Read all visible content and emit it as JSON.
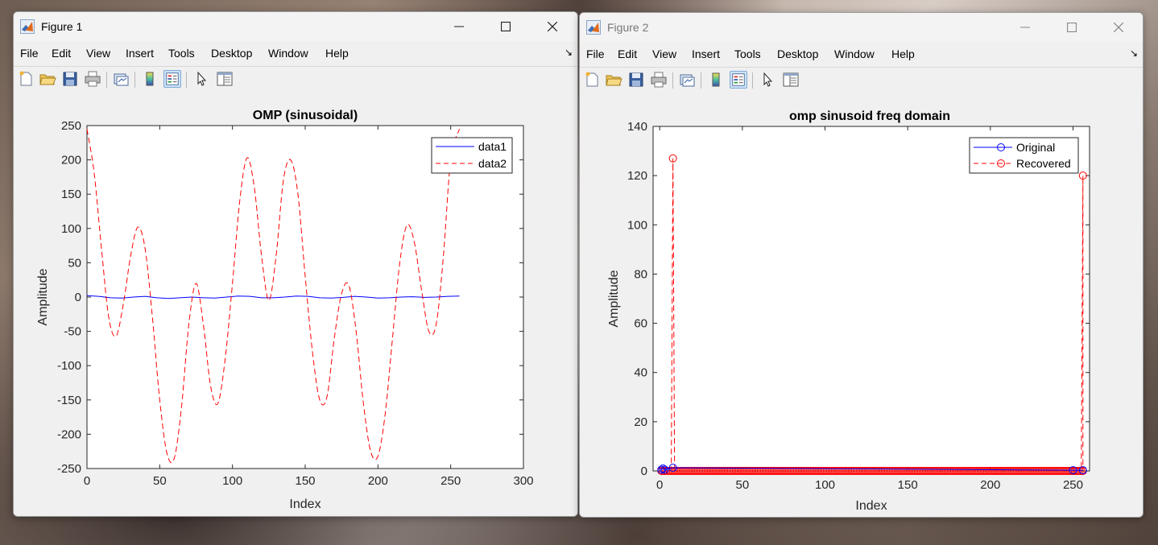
{
  "figure1": {
    "title": "Figure 1",
    "menu": [
      "File",
      "Edit",
      "View",
      "Insert",
      "Tools",
      "Desktop",
      "Window",
      "Help"
    ],
    "chart": {
      "type": "line",
      "title": "OMP (sinusoidal)",
      "xlabel": "Index",
      "ylabel": "Amplitude",
      "xlim": [
        0,
        300
      ],
      "ylim": [
        -250,
        250
      ],
      "xticks": [
        "0",
        "50",
        "100",
        "150",
        "200",
        "250",
        "300"
      ],
      "yticks": [
        "250",
        "200",
        "150",
        "100",
        "50",
        "0",
        "-50",
        "-100",
        "-150",
        "-200",
        "-250"
      ],
      "legend": [
        "data1",
        "data2"
      ],
      "colors": {
        "data1": "#0000ff",
        "data2": "#ff0000"
      }
    }
  },
  "figure2": {
    "title": "Figure 2",
    "menu": [
      "File",
      "Edit",
      "View",
      "Insert",
      "Tools",
      "Desktop",
      "Window",
      "Help"
    ],
    "chart": {
      "type": "scatter",
      "title": "omp sinusoid freq domain",
      "xlabel": "Index",
      "ylabel": "Amplitude",
      "xlim": [
        -4,
        260
      ],
      "ylim": [
        0,
        140
      ],
      "xticks": [
        "0",
        "50",
        "100",
        "150",
        "200",
        "250"
      ],
      "yticks": [
        "140",
        "120",
        "100",
        "80",
        "60",
        "40",
        "20",
        "0"
      ],
      "legend": [
        "Original",
        "Recovered"
      ],
      "colors": {
        "Original": "#0000ff",
        "Recovered": "#ff0000"
      }
    }
  },
  "chart_data": [
    {
      "type": "line",
      "title": "OMP (sinusoidal)",
      "xlabel": "Index",
      "ylabel": "Amplitude",
      "xlim": [
        0,
        300
      ],
      "ylim": [
        -250,
        250
      ],
      "grid": false,
      "legend_position": "top-right",
      "series": [
        {
          "name": "data1",
          "style": "solid",
          "x": [
            0,
            8,
            16,
            24,
            32,
            40,
            48,
            56,
            64,
            72,
            80,
            88,
            96,
            104,
            112,
            120,
            128,
            136,
            144,
            152,
            160,
            168,
            176,
            184,
            192,
            200,
            208,
            216,
            224,
            232,
            240,
            248,
            256
          ],
          "y": [
            2,
            1,
            -1,
            -1.5,
            0,
            1,
            -1,
            -2,
            -1,
            0,
            -1,
            -1.5,
            0,
            1.5,
            1,
            -1,
            -1,
            0,
            1.5,
            1,
            -1,
            -1.5,
            -0.5,
            1,
            0,
            -1.5,
            -1,
            0,
            0.5,
            -0.5,
            0,
            1,
            1.5
          ]
        },
        {
          "name": "data2",
          "style": "dashed",
          "x": [
            0,
            5,
            10,
            15,
            20,
            25,
            30,
            35,
            40,
            45,
            50,
            55,
            60,
            65,
            70,
            75,
            80,
            85,
            90,
            95,
            100,
            105,
            110,
            115,
            120,
            125,
            130,
            135,
            140,
            145,
            150,
            155,
            160,
            165,
            170,
            175,
            180,
            185,
            190,
            195,
            200,
            205,
            210,
            215,
            220,
            225,
            230,
            235,
            240,
            245,
            250,
            256
          ],
          "y": [
            245,
            180,
            70,
            -30,
            -57,
            -10,
            60,
            102,
            70,
            -30,
            -150,
            -228,
            -235,
            -160,
            -40,
            20,
            -40,
            -130,
            -155,
            -90,
            20,
            140,
            203,
            160,
            60,
            -5,
            60,
            170,
            200,
            150,
            30,
            -80,
            -150,
            -145,
            -60,
            5,
            17,
            -50,
            -155,
            -225,
            -232,
            -170,
            -60,
            50,
            105,
            80,
            10,
            -50,
            -40,
            60,
            200,
            245
          ]
        }
      ]
    },
    {
      "type": "scatter",
      "title": "omp sinusoid freq domain",
      "xlabel": "Index",
      "ylabel": "Amplitude",
      "xlim": [
        -4,
        260
      ],
      "ylim": [
        0,
        140
      ],
      "grid": false,
      "legend_position": "top-right",
      "series": [
        {
          "name": "Original",
          "marker": "circle",
          "style": "solid",
          "x": [
            1,
            2,
            3,
            8,
            250,
            256
          ],
          "y": [
            0.5,
            1,
            0.5,
            1.3,
            0.3,
            0.3
          ]
        },
        {
          "name": "Recovered",
          "marker": "circle",
          "style": "dashed",
          "peaks": [
            {
              "x": 8,
              "y": 127
            },
            {
              "x": 256,
              "y": 120
            }
          ],
          "baseline": {
            "x_start": 1,
            "x_end": 256,
            "y": 0
          }
        }
      ]
    }
  ]
}
